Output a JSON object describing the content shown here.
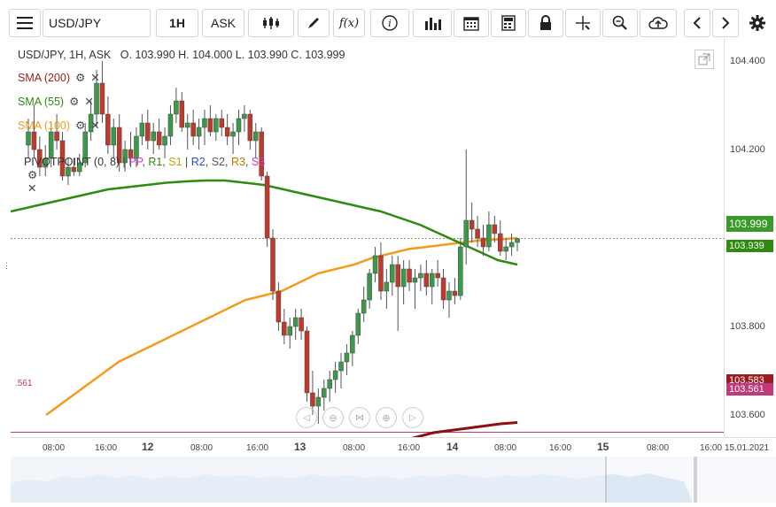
{
  "toolbar": {
    "symbol": "USD/JPY",
    "interval": "1H",
    "price_type": "ASK",
    "icons": [
      "menu-icon",
      "chart-type-icon",
      "pencil-icon",
      "function-icon",
      "info-icon",
      "bar-chart-icon",
      "calendar-icon",
      "calculator-icon",
      "lock-icon",
      "crosshair-icon",
      "zoom-icon",
      "cloud-upload-icon",
      "prev-icon",
      "next-icon",
      "gear-icon"
    ]
  },
  "info": {
    "line": "USD/JPY, 1H, ASK   O. 103.990 H. 104.000 L. 103.990 C. 103.999"
  },
  "indicators": [
    {
      "label": "SMA (200)",
      "color": "#9b1c1c"
    },
    {
      "label": "SMA (55)",
      "color": "#2e8b10"
    },
    {
      "label": "SMA (100)",
      "color": "#f59a1a"
    }
  ],
  "pivot": {
    "label": "PIVOTPOINT (0, 8)",
    "parts": [
      {
        "t": " | ",
        "c": "#444"
      },
      {
        "t": "PP",
        "c": "#c03cc0"
      },
      {
        "t": ", ",
        "c": "#444"
      },
      {
        "t": "R1",
        "c": "#2e8b10"
      },
      {
        "t": ", ",
        "c": "#444"
      },
      {
        "t": "S1",
        "c": "#c8a000"
      },
      {
        "t": " | ",
        "c": "#444"
      },
      {
        "t": "R2",
        "c": "#3050c0"
      },
      {
        "t": ", ",
        "c": "#444"
      },
      {
        "t": "S2",
        "c": "#555"
      },
      {
        "t": ", ",
        "c": "#444"
      },
      {
        "t": "R3",
        "c": "#c07a00"
      },
      {
        "t": ", ",
        "c": "#444"
      },
      {
        "t": "S3",
        "c": "#c03cc0"
      }
    ]
  },
  "price_axis": {
    "labels": [
      "104.400",
      "104.200",
      "103.800",
      "103.600"
    ],
    "tags": [
      {
        "value": "103.999",
        "bg": "#3a9a2a"
      },
      {
        "value": "103.939",
        "bg": "#2e8b10"
      },
      {
        "value": "103.583",
        "bg": "#9b1c1c"
      },
      {
        "value": "103.561",
        "bg": "#c03a7a"
      }
    ]
  },
  "fib_label": ".561",
  "time_axis": [
    {
      "label": "08:00"
    },
    {
      "label": "16:00"
    },
    {
      "label": "12",
      "bold": true
    },
    {
      "label": "08:00"
    },
    {
      "label": "16:00"
    },
    {
      "label": "13",
      "bold": true
    },
    {
      "label": "08:00"
    },
    {
      "label": "16:00"
    },
    {
      "label": "14",
      "bold": true
    },
    {
      "label": "08:00"
    },
    {
      "label": "16:00"
    },
    {
      "label": "15",
      "bold": true
    },
    {
      "label": "08:00"
    },
    {
      "label": "16:00"
    },
    {
      "label": "15.01.2021"
    }
  ],
  "chart_data": {
    "type": "candlestick",
    "symbol": "USD/JPY",
    "ylim": [
      103.55,
      104.45
    ],
    "candles": [
      {
        "o": 104.21,
        "h": 104.27,
        "l": 104.18,
        "c": 104.24
      },
      {
        "o": 104.24,
        "h": 104.3,
        "l": 104.18,
        "c": 104.2
      },
      {
        "o": 104.2,
        "h": 104.23,
        "l": 104.14,
        "c": 104.16
      },
      {
        "o": 104.16,
        "h": 104.21,
        "l": 104.14,
        "c": 104.18
      },
      {
        "o": 104.18,
        "h": 104.26,
        "l": 104.16,
        "c": 104.24
      },
      {
        "o": 104.24,
        "h": 104.28,
        "l": 104.2,
        "c": 104.22
      },
      {
        "o": 104.22,
        "h": 104.24,
        "l": 104.13,
        "c": 104.14
      },
      {
        "o": 104.14,
        "h": 104.18,
        "l": 104.12,
        "c": 104.16
      },
      {
        "o": 104.16,
        "h": 104.18,
        "l": 104.14,
        "c": 104.15
      },
      {
        "o": 104.15,
        "h": 104.19,
        "l": 104.14,
        "c": 104.17
      },
      {
        "o": 104.17,
        "h": 104.26,
        "l": 104.16,
        "c": 104.24
      },
      {
        "o": 104.24,
        "h": 104.31,
        "l": 104.22,
        "c": 104.28
      },
      {
        "o": 104.28,
        "h": 104.38,
        "l": 104.25,
        "c": 104.35
      },
      {
        "o": 104.35,
        "h": 104.4,
        "l": 104.26,
        "c": 104.28
      },
      {
        "o": 104.28,
        "h": 104.32,
        "l": 104.19,
        "c": 104.21
      },
      {
        "o": 104.21,
        "h": 104.27,
        "l": 104.18,
        "c": 104.25
      },
      {
        "o": 104.25,
        "h": 104.28,
        "l": 104.15,
        "c": 104.17
      },
      {
        "o": 104.17,
        "h": 104.22,
        "l": 104.15,
        "c": 104.2
      },
      {
        "o": 104.2,
        "h": 104.24,
        "l": 104.16,
        "c": 104.18
      },
      {
        "o": 104.18,
        "h": 104.25,
        "l": 104.16,
        "c": 104.23
      },
      {
        "o": 104.23,
        "h": 104.28,
        "l": 104.21,
        "c": 104.26
      },
      {
        "o": 104.26,
        "h": 104.29,
        "l": 104.2,
        "c": 104.22
      },
      {
        "o": 104.22,
        "h": 104.26,
        "l": 104.19,
        "c": 104.24
      },
      {
        "o": 104.24,
        "h": 104.27,
        "l": 104.2,
        "c": 104.21
      },
      {
        "o": 104.21,
        "h": 104.25,
        "l": 104.18,
        "c": 104.23
      },
      {
        "o": 104.23,
        "h": 104.3,
        "l": 104.21,
        "c": 104.28
      },
      {
        "o": 104.28,
        "h": 104.34,
        "l": 104.26,
        "c": 104.31
      },
      {
        "o": 104.31,
        "h": 104.33,
        "l": 104.24,
        "c": 104.25
      },
      {
        "o": 104.25,
        "h": 104.28,
        "l": 104.2,
        "c": 104.26
      },
      {
        "o": 104.26,
        "h": 104.29,
        "l": 104.21,
        "c": 104.23
      },
      {
        "o": 104.23,
        "h": 104.27,
        "l": 104.2,
        "c": 104.25
      },
      {
        "o": 104.25,
        "h": 104.29,
        "l": 104.21,
        "c": 104.27
      },
      {
        "o": 104.27,
        "h": 104.3,
        "l": 104.23,
        "c": 104.24
      },
      {
        "o": 104.24,
        "h": 104.28,
        "l": 104.22,
        "c": 104.27
      },
      {
        "o": 104.27,
        "h": 104.29,
        "l": 104.23,
        "c": 104.25
      },
      {
        "o": 104.25,
        "h": 104.28,
        "l": 104.21,
        "c": 104.23
      },
      {
        "o": 104.23,
        "h": 104.26,
        "l": 104.19,
        "c": 104.24
      },
      {
        "o": 104.24,
        "h": 104.29,
        "l": 104.21,
        "c": 104.27
      },
      {
        "o": 104.27,
        "h": 104.3,
        "l": 104.24,
        "c": 104.28
      },
      {
        "o": 104.28,
        "h": 104.29,
        "l": 104.2,
        "c": 104.22
      },
      {
        "o": 104.22,
        "h": 104.26,
        "l": 104.18,
        "c": 104.24
      },
      {
        "o": 104.24,
        "h": 104.25,
        "l": 104.13,
        "c": 104.14
      },
      {
        "o": 104.14,
        "h": 104.15,
        "l": 103.98,
        "c": 104.0
      },
      {
        "o": 104.0,
        "h": 104.02,
        "l": 103.86,
        "c": 103.88
      },
      {
        "o": 103.88,
        "h": 103.9,
        "l": 103.79,
        "c": 103.81
      },
      {
        "o": 103.81,
        "h": 103.84,
        "l": 103.76,
        "c": 103.78
      },
      {
        "o": 103.78,
        "h": 103.82,
        "l": 103.75,
        "c": 103.8
      },
      {
        "o": 103.8,
        "h": 103.84,
        "l": 103.77,
        "c": 103.82
      },
      {
        "o": 103.82,
        "h": 103.84,
        "l": 103.77,
        "c": 103.79
      },
      {
        "o": 103.79,
        "h": 103.8,
        "l": 103.63,
        "c": 103.65
      },
      {
        "o": 103.65,
        "h": 103.7,
        "l": 103.6,
        "c": 103.62
      },
      {
        "o": 103.62,
        "h": 103.66,
        "l": 103.58,
        "c": 103.64
      },
      {
        "o": 103.64,
        "h": 103.68,
        "l": 103.61,
        "c": 103.66
      },
      {
        "o": 103.66,
        "h": 103.7,
        "l": 103.63,
        "c": 103.68
      },
      {
        "o": 103.68,
        "h": 103.72,
        "l": 103.65,
        "c": 103.7
      },
      {
        "o": 103.7,
        "h": 103.74,
        "l": 103.66,
        "c": 103.72
      },
      {
        "o": 103.72,
        "h": 103.76,
        "l": 103.69,
        "c": 103.74
      },
      {
        "o": 103.74,
        "h": 103.79,
        "l": 103.71,
        "c": 103.78
      },
      {
        "o": 103.78,
        "h": 103.84,
        "l": 103.76,
        "c": 103.83
      },
      {
        "o": 103.83,
        "h": 103.89,
        "l": 103.81,
        "c": 103.86
      },
      {
        "o": 103.86,
        "h": 103.93,
        "l": 103.84,
        "c": 103.92
      },
      {
        "o": 103.92,
        "h": 103.98,
        "l": 103.9,
        "c": 103.96
      },
      {
        "o": 103.96,
        "h": 103.99,
        "l": 103.86,
        "c": 103.88
      },
      {
        "o": 103.88,
        "h": 103.93,
        "l": 103.84,
        "c": 103.9
      },
      {
        "o": 103.9,
        "h": 103.96,
        "l": 103.87,
        "c": 103.94
      },
      {
        "o": 103.94,
        "h": 103.96,
        "l": 103.79,
        "c": 103.89
      },
      {
        "o": 103.89,
        "h": 103.95,
        "l": 103.85,
        "c": 103.93
      },
      {
        "o": 103.93,
        "h": 103.95,
        "l": 103.88,
        "c": 103.9
      },
      {
        "o": 103.9,
        "h": 103.93,
        "l": 103.84,
        "c": 103.91
      },
      {
        "o": 103.91,
        "h": 103.94,
        "l": 103.88,
        "c": 103.92
      },
      {
        "o": 103.92,
        "h": 103.95,
        "l": 103.87,
        "c": 103.89
      },
      {
        "o": 103.89,
        "h": 103.93,
        "l": 103.85,
        "c": 103.92
      },
      {
        "o": 103.92,
        "h": 103.95,
        "l": 103.89,
        "c": 103.91
      },
      {
        "o": 103.91,
        "h": 103.93,
        "l": 103.84,
        "c": 103.86
      },
      {
        "o": 103.86,
        "h": 103.9,
        "l": 103.82,
        "c": 103.88
      },
      {
        "o": 103.88,
        "h": 103.91,
        "l": 103.85,
        "c": 103.87
      },
      {
        "o": 103.87,
        "h": 104.0,
        "l": 103.86,
        "c": 103.98
      },
      {
        "o": 103.98,
        "h": 104.2,
        "l": 103.94,
        "c": 104.04
      },
      {
        "o": 104.04,
        "h": 104.08,
        "l": 103.99,
        "c": 104.02
      },
      {
        "o": 104.02,
        "h": 104.05,
        "l": 103.98,
        "c": 104.0
      },
      {
        "o": 104.0,
        "h": 104.03,
        "l": 103.96,
        "c": 103.98
      },
      {
        "o": 103.98,
        "h": 104.06,
        "l": 103.97,
        "c": 104.03
      },
      {
        "o": 104.03,
        "h": 104.05,
        "l": 103.99,
        "c": 104.01
      },
      {
        "o": 104.01,
        "h": 104.04,
        "l": 103.96,
        "c": 103.97
      },
      {
        "o": 103.97,
        "h": 104.0,
        "l": 103.95,
        "c": 103.98
      },
      {
        "o": 103.98,
        "h": 104.01,
        "l": 103.96,
        "c": 103.99
      },
      {
        "o": 103.99,
        "h": 104.0,
        "l": 103.97,
        "c": 103.999
      }
    ],
    "sma55": [
      104.06,
      104.07,
      104.08,
      104.09,
      104.1,
      104.11,
      104.115,
      104.12,
      104.125,
      104.128,
      104.13,
      104.13,
      104.125,
      104.12,
      104.11,
      104.1,
      104.09,
      104.08,
      104.07,
      104.06,
      104.045,
      104.03,
      104.01,
      103.99,
      103.97,
      103.95,
      103.94
    ],
    "sma100": [
      103.6,
      103.63,
      103.66,
      103.69,
      103.72,
      103.74,
      103.76,
      103.78,
      103.8,
      103.82,
      103.84,
      103.86,
      103.87,
      103.88,
      103.9,
      103.92,
      103.93,
      103.94,
      103.955,
      103.965,
      103.975,
      103.98,
      103.985,
      103.99,
      103.995,
      103.997,
      104.0
    ],
    "sma200": [
      103.4,
      103.42,
      103.44,
      103.46,
      103.48,
      103.49,
      103.5,
      103.51,
      103.52,
      103.53,
      103.54,
      103.55,
      103.56,
      103.565,
      103.57,
      103.575,
      103.58,
      103.583
    ],
    "horizontal_lines": [
      103.999,
      103.561
    ]
  }
}
